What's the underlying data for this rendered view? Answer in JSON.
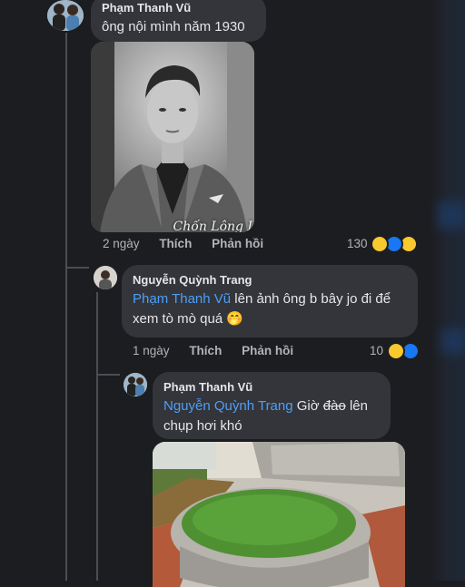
{
  "comment1": {
    "author": "Phạm Thanh Vũ",
    "text": "ông nội mình năm 1930",
    "photo_caption": "Chốn Lông Lày",
    "time": "2 ngày",
    "like_label": "Thích",
    "reply_label": "Phản hồi",
    "reaction_count": "130",
    "reactions": [
      "haha",
      "like",
      "wow"
    ]
  },
  "comment2": {
    "author": "Nguyễn Quỳnh Trang",
    "mention": "Phạm Thanh Vũ",
    "text_line1": " lên ảnh ông b bây jo đi để",
    "text_line2": "xem tò mò quá 🤭",
    "time": "1 ngày",
    "like_label": "Thích",
    "reply_label": "Phản hồi",
    "reaction_count": "10",
    "reactions": [
      "haha",
      "like"
    ]
  },
  "comment3": {
    "author": "Phạm Thanh Vũ",
    "mention": "Nguyễn Quỳnh Trang",
    "text_pre": " Giờ ",
    "text_strike": "đào",
    "text_post": " lên",
    "text_line2": "chụp hơi khó"
  },
  "colors": {
    "background": "#1c1d20",
    "bubble": "#33353a",
    "mention": "#4f9ef7",
    "meta_text": "#b0b3b8"
  }
}
